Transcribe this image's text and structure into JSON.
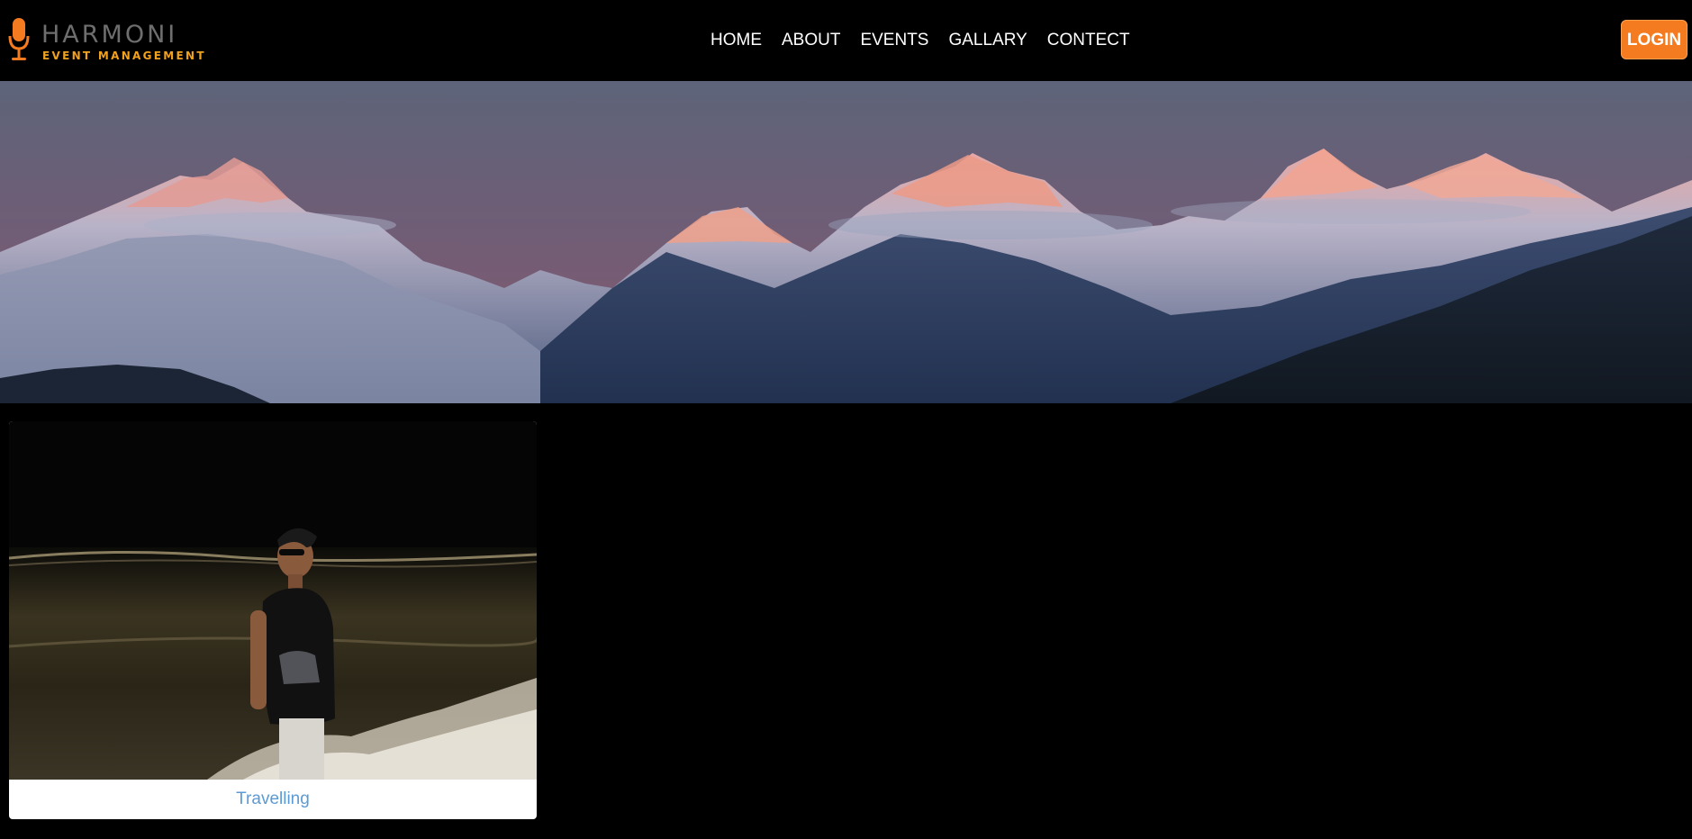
{
  "brand": {
    "name": "HARMONI",
    "tagline": "EVENT MANAGEMENT",
    "logo_icon": "microphone-icon",
    "accent_color": "#f47b1f",
    "tagline_color": "#f0a21e"
  },
  "nav": {
    "items": [
      {
        "label": "HOME"
      },
      {
        "label": "ABOUT"
      },
      {
        "label": "EVENTS"
      },
      {
        "label": "GALLARY"
      },
      {
        "label": "CONTECT"
      }
    ],
    "login_label": "LOGIN"
  },
  "hero": {
    "image": "mountain-range-at-dusk"
  },
  "gallery": {
    "cards": [
      {
        "image": "person-at-night-beach",
        "caption": "Travelling"
      }
    ]
  }
}
